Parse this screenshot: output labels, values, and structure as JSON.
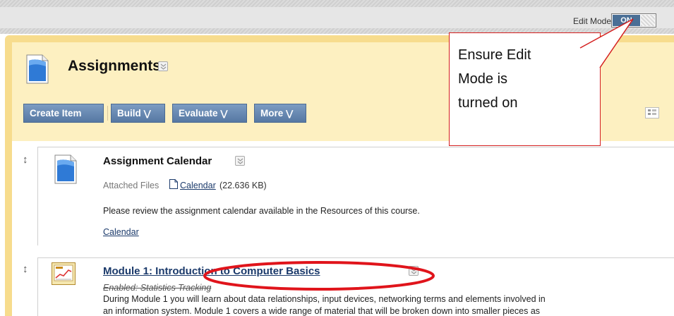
{
  "topbar": {
    "edit_mode_label": "Edit Mode:",
    "edit_mode_value": "ON"
  },
  "page": {
    "title": "Assignments"
  },
  "toolbar": {
    "create_item": "Create Item",
    "build": "Build",
    "evaluate": "Evaluate",
    "more": "More"
  },
  "items": [
    {
      "title": "Assignment Calendar",
      "attached_files_label": "Attached Files",
      "file_name": "Calendar",
      "file_size": "(22.636 KB)",
      "description": "Please review the assignment calendar available in the Resources of this course.",
      "link": "Calendar"
    },
    {
      "title": "Module 1: Introduction to Computer Basics",
      "status": "Enabled: Statistics Tracking",
      "description_line1": "During Module 1 you will learn about data relationships, input devices, networking terms and elements involved in",
      "description_line2": "an information system.  Module 1 covers a wide range of material that will be broken down into smaller pieces as"
    }
  ],
  "callout": {
    "line1": "Ensure Edit",
    "line2": "Mode is",
    "line3": "turned on"
  },
  "colors": {
    "annotation": "#e0141b",
    "button": "#5e7fa8",
    "header_bg": "#fdf0c1",
    "header_border": "#f7dc8d",
    "link": "#1b3a6b"
  }
}
